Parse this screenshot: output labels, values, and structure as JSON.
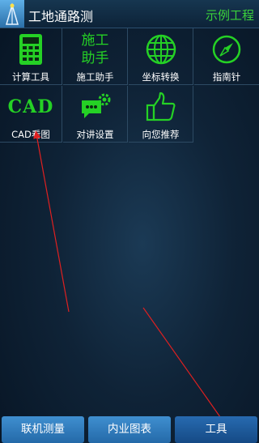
{
  "header": {
    "app_title": "工地通路测",
    "project_name": "示例工程"
  },
  "tools": [
    {
      "label": "计算工具",
      "icon": "calculator-icon"
    },
    {
      "label": "施工助手",
      "icon_text_line1": "施工",
      "icon_text_line2": "助手"
    },
    {
      "label": "坐标转换",
      "icon": "globe-icon"
    },
    {
      "label": "指南针",
      "icon": "compass-icon"
    },
    {
      "label": "CAD看图",
      "icon_text": "CAD"
    },
    {
      "label": "对讲设置",
      "icon": "chat-gear-icon"
    },
    {
      "label": "向您推荐",
      "icon": "thumbs-up-icon"
    }
  ],
  "bottom_tabs": [
    {
      "label": "联机测量"
    },
    {
      "label": "内业图表"
    },
    {
      "label": "工具",
      "active": true
    }
  ],
  "colors": {
    "icon_green": "#25d125",
    "title_green": "#3bd23b",
    "tab_blue": "#3f8fd0",
    "annotation_red": "#e02020"
  }
}
